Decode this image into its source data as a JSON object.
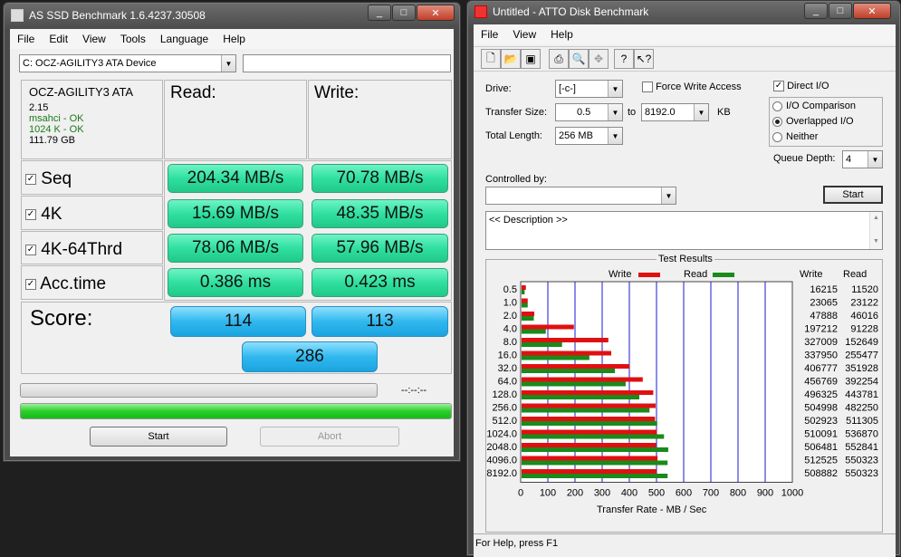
{
  "asssd": {
    "title": "AS SSD Benchmark 1.6.4237.30508",
    "menu": [
      "File",
      "Edit",
      "View",
      "Tools",
      "Language",
      "Help"
    ],
    "device": "C: OCZ-AGILITY3 ATA Device",
    "info": {
      "model": "OCZ-AGILITY3 ATA",
      "fw": "2.15",
      "driver": "msahci - OK",
      "align": "1024 K - OK",
      "size": "111.79 GB"
    },
    "headers": {
      "read": "Read:",
      "write": "Write:"
    },
    "rows": [
      {
        "label": "Seq",
        "read": "204.34 MB/s",
        "write": "70.78 MB/s"
      },
      {
        "label": "4K",
        "read": "15.69 MB/s",
        "write": "48.35 MB/s"
      },
      {
        "label": "4K-64Thrd",
        "read": "78.06 MB/s",
        "write": "57.96 MB/s"
      },
      {
        "label": "Acc.time",
        "read": "0.386 ms",
        "write": "0.423 ms"
      }
    ],
    "score": {
      "label": "Score:",
      "read": "114",
      "write": "113",
      "total": "286"
    },
    "time": "--:--:--",
    "start": "Start",
    "abort": "Abort",
    "progress": 1.0,
    "colors": {
      "green": "#30e0a0",
      "blue": "#30b8ee",
      "ok": "#1a7a1a"
    }
  },
  "atto": {
    "title": "Untitled - ATTO Disk Benchmark",
    "menu": [
      "File",
      "View",
      "Help"
    ],
    "drive_label": "Drive:",
    "drive": "[-c-]",
    "force_write": "Force Write Access",
    "direct_io": "Direct I/O",
    "transfer_label": "Transfer Size:",
    "transfer_from": "0.5",
    "to_label": "to",
    "transfer_to": "8192.0",
    "kb": "KB",
    "length_label": "Total Length:",
    "length": "256 MB",
    "io_comparison": "I/O Comparison",
    "overlapped": "Overlapped I/O",
    "neither": "Neither",
    "queue_label": "Queue Depth:",
    "queue": "4",
    "controlled_label": "Controlled by:",
    "start": "Start",
    "description": "<< Description >>",
    "results_title": "Test Results",
    "legend_write": "Write",
    "legend_read": "Read",
    "col_write": "Write",
    "col_read": "Read",
    "xlabel": "Transfer Rate - MB / Sec",
    "status": "For Help, press F1",
    "colors": {
      "write": "#e01010",
      "read": "#1a8a1a",
      "grid": "#1a1ad0"
    }
  },
  "chart_data": {
    "type": "bar",
    "title": "Test Results",
    "xlabel": "Transfer Rate - MB / Sec",
    "xlim": [
      0,
      1000
    ],
    "xticks": [
      "0",
      "100",
      "200",
      "300",
      "400",
      "500",
      "600",
      "700",
      "800",
      "900",
      "1000"
    ],
    "categories": [
      "0.5",
      "1.0",
      "2.0",
      "4.0",
      "8.0",
      "16.0",
      "32.0",
      "64.0",
      "128.0",
      "256.0",
      "512.0",
      "1024.0",
      "2048.0",
      "4096.0",
      "8192.0"
    ],
    "series": [
      {
        "name": "Write",
        "values_kb": [
          "16215",
          "23065",
          "47888",
          "197212",
          "327009",
          "337950",
          "406777",
          "456769",
          "496325",
          "504998",
          "502923",
          "510091",
          "506481",
          "512525",
          "508882"
        ]
      },
      {
        "name": "Read",
        "values_kb": [
          "11520",
          "23122",
          "46016",
          "91228",
          "152649",
          "255477",
          "351928",
          "392254",
          "443781",
          "482250",
          "511305",
          "536870",
          "552841",
          "550323",
          "550323"
        ]
      }
    ]
  }
}
